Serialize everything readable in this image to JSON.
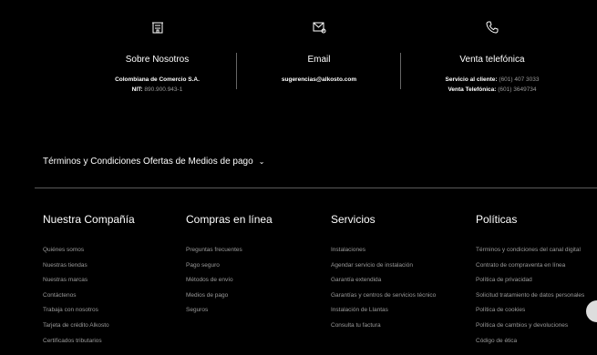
{
  "contact": {
    "about": {
      "title": "Sobre Nosotros",
      "line1": "Colombiana de Comercio S.A.",
      "nit_label": "NIT:",
      "nit_value": "890.900.943-1"
    },
    "email": {
      "title": "Email",
      "address": "sugerencias@alkosto.com"
    },
    "phone": {
      "title": "Venta telefónica",
      "service_label": "Servicio al cliente:",
      "service_value": "(601) 407 3033",
      "sales_label": "Venta Telefónica:",
      "sales_value": "(601) 3649734"
    }
  },
  "terms_link": "Términos y Condiciones Ofertas de Medios de pago",
  "footer": {
    "company": {
      "title": "Nuestra Compañía",
      "items": [
        "Quiénes somos",
        "Nuestras tiendas",
        "Nuestras marcas",
        "Contáctenos",
        "Trabaja con nosotros",
        "Tarjeta de crédito Alkosto",
        "Certificados tributarios"
      ]
    },
    "online": {
      "title": "Compras en línea",
      "items": [
        "Preguntas frecuentes",
        "Pago seguro",
        "Métodos de envío",
        "Medios de pago",
        "Seguros"
      ]
    },
    "services": {
      "title": "Servicios",
      "items": [
        "Instalaciones",
        "Agendar servicio de instalación",
        "Garantía extendida",
        "Garantías y centros de servicios técnico",
        "Instalación de Llantas",
        "Consulta tu factura"
      ]
    },
    "policies": {
      "title": "Políticas",
      "items": [
        "Términos y condiciones del canal digital",
        "Contrato de compraventa en línea",
        "Política de privacidad",
        "Solicitud tratamiento de datos personales",
        "Política de cookies",
        "Política de cambios y devoluciones",
        "Código de ética"
      ]
    }
  }
}
